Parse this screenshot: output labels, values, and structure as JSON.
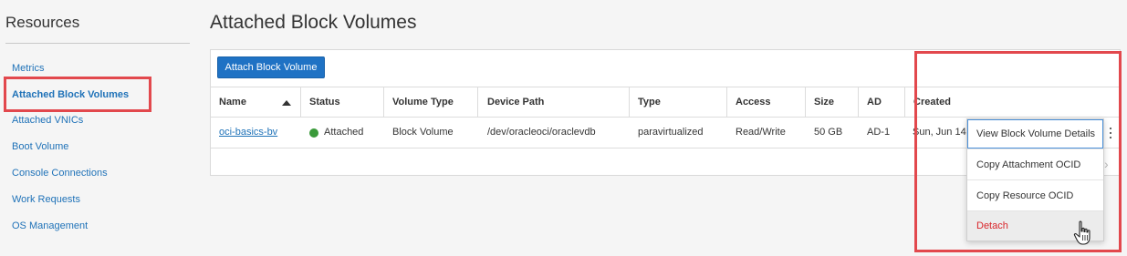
{
  "sidebar": {
    "title": "Resources",
    "items": [
      {
        "label": "Metrics",
        "active": false
      },
      {
        "label": "Attached Block Volumes",
        "active": true
      },
      {
        "label": "Attached VNICs",
        "active": false
      },
      {
        "label": "Boot Volume",
        "active": false
      },
      {
        "label": "Console Connections",
        "active": false
      },
      {
        "label": "Work Requests",
        "active": false
      },
      {
        "label": "OS Management",
        "active": false
      }
    ]
  },
  "main": {
    "title": "Attached Block Volumes",
    "attach_button": "Attach Block Volume",
    "table": {
      "columns": [
        "Name",
        "Status",
        "Volume Type",
        "Device Path",
        "Type",
        "Access",
        "Size",
        "AD",
        "Created"
      ],
      "sort_column": "Name",
      "sort_direction": "ascending",
      "rows": [
        {
          "name": "oci-basics-bv",
          "status": "Attached",
          "volume_type": "Block Volume",
          "device_path": "/dev/oracleoci/oraclevdb",
          "type": "paravirtualized",
          "access": "Read/Write",
          "size": "50 GB",
          "ad": "AD-1",
          "created": "Sun, Jun 14"
        }
      ]
    },
    "row_menu": {
      "items": [
        {
          "label": "View Block Volume Details"
        },
        {
          "label": "Copy Attachment OCID"
        },
        {
          "label": "Copy Resource OCID"
        },
        {
          "label": "Detach"
        }
      ]
    }
  },
  "colors": {
    "accent": "#1f72c4",
    "link": "#1f72b8",
    "status_attached": "#3a9a3a",
    "danger": "#d9252a",
    "highlight_box": "#e2484d"
  },
  "icons": {
    "sort": "sort-ascending-icon",
    "status": "status-dot-icon",
    "kebab": "kebab-menu-icon",
    "next": "chevron-right-icon",
    "cursor": "hand-pointer-icon"
  }
}
